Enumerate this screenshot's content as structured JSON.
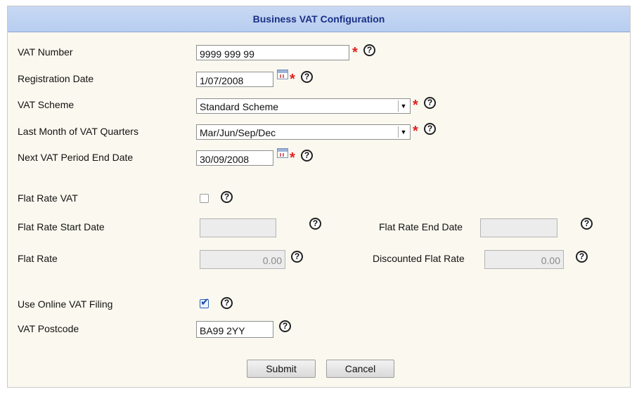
{
  "form": {
    "title": "Business VAT Configuration",
    "vat_number": {
      "label": "VAT Number",
      "value": "9999 999 99"
    },
    "registration_date": {
      "label": "Registration Date",
      "value": "1/07/2008"
    },
    "vat_scheme": {
      "label": "VAT Scheme",
      "value": "Standard Scheme"
    },
    "last_month_quarters": {
      "label": "Last Month of VAT Quarters",
      "value": "Mar/Jun/Sep/Dec"
    },
    "next_period_end": {
      "label": "Next VAT Period End Date",
      "value": "30/09/2008"
    },
    "flat_rate_vat": {
      "label": "Flat Rate VAT",
      "checked": false
    },
    "flat_rate_start": {
      "label": "Flat Rate Start Date",
      "value": ""
    },
    "flat_rate_end": {
      "label": "Flat Rate End Date",
      "value": ""
    },
    "flat_rate": {
      "label": "Flat Rate",
      "value": "0.00"
    },
    "discounted_flat_rate": {
      "label": "Discounted Flat Rate",
      "value": "0.00"
    },
    "online_filing": {
      "label": "Use Online VAT Filing",
      "checked": true
    },
    "vat_postcode": {
      "label": "VAT Postcode",
      "value": "BA99 2YY"
    },
    "required_mark": "*",
    "help_glyph": "?",
    "check_glyph": "✔",
    "select_arrow_glyph": "▼"
  },
  "buttons": {
    "submit": "Submit",
    "cancel": "Cancel"
  },
  "colors": {
    "title_bg": "#b8cef0",
    "title_text": "#1b2f86",
    "panel_bg": "#fbf9ef",
    "required": "#e12020"
  }
}
